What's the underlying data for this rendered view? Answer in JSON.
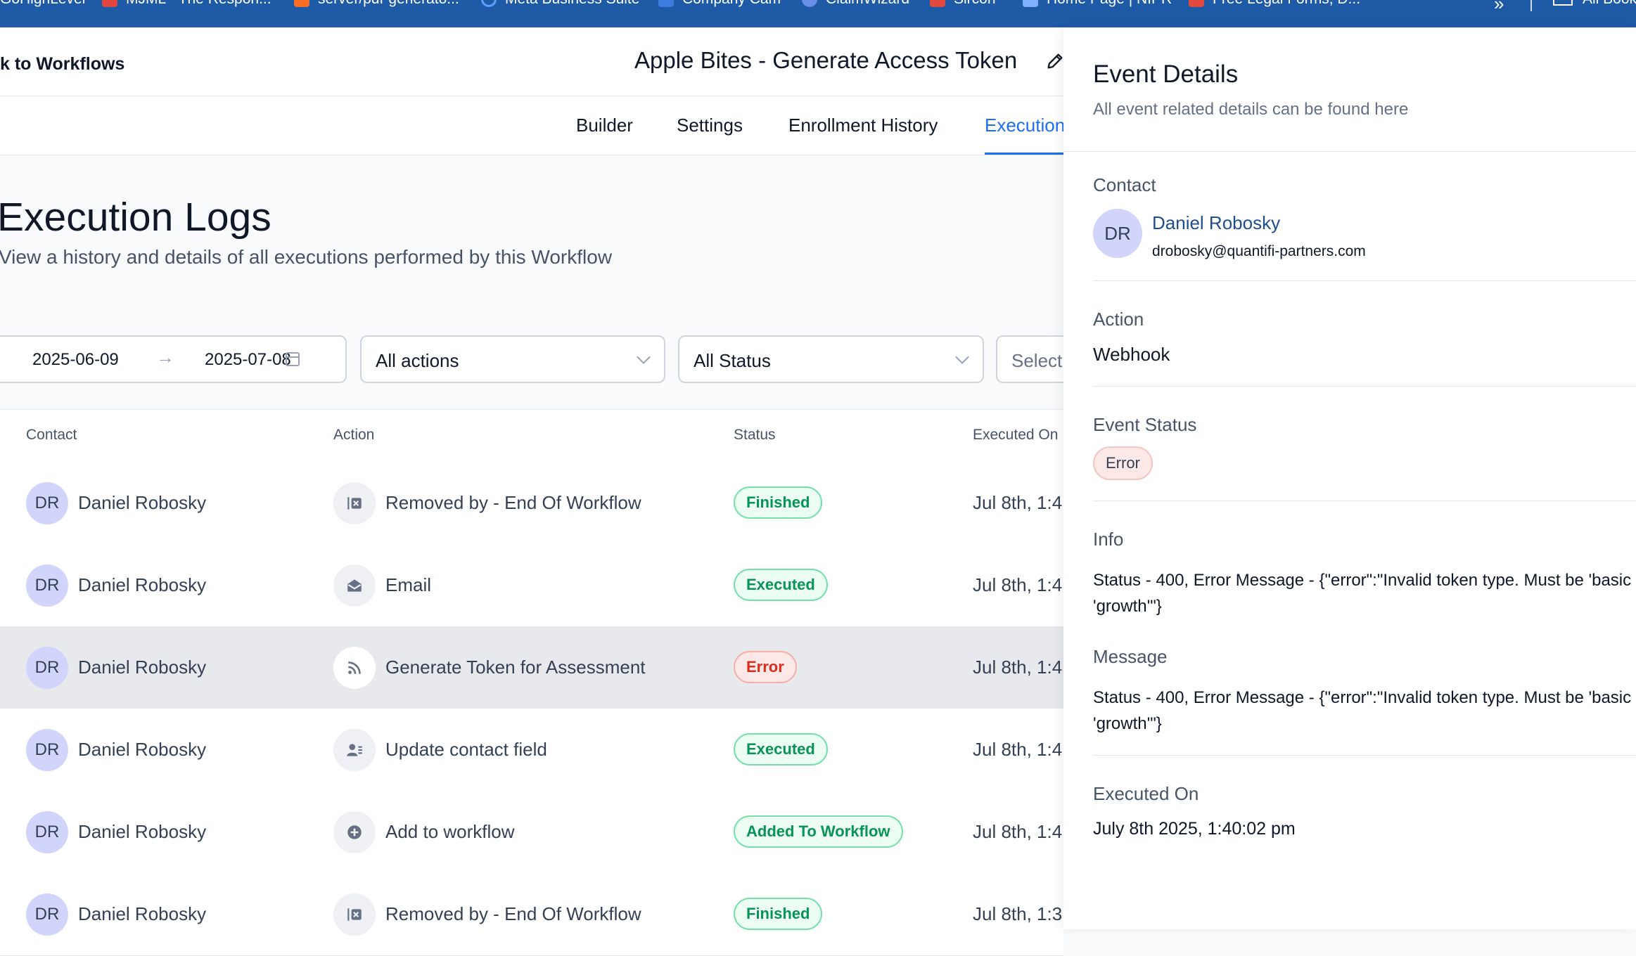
{
  "bookmarks": [
    {
      "label": "GoHighLevel",
      "icon": "ghl-icon",
      "color": "#ffffff"
    },
    {
      "label": "MJML - The Respon...",
      "icon": "mjml-icon",
      "color": "#e2473f"
    },
    {
      "label": "server/pdf-generato...",
      "icon": "gitlab-icon",
      "color": "#fc6d26"
    },
    {
      "label": "Meta Business Suite",
      "icon": "meta-icon",
      "color": "#5aa0ff"
    },
    {
      "label": "Company Cam",
      "icon": "camera-icon",
      "color": "#3d7de0"
    },
    {
      "label": "ClaimWizard",
      "icon": "wizard-icon",
      "color": "#6a8fe8"
    },
    {
      "label": "Sircon",
      "icon": "sircon-icon",
      "color": "#e24a3f"
    },
    {
      "label": "Home Page | NIPR",
      "icon": "nipr-icon",
      "color": "#7fb0ff"
    },
    {
      "label": "Free Legal Forms, D...",
      "icon": "legal-icon",
      "color": "#e24a3f"
    }
  ],
  "bookmarks_overflow": "»",
  "bookmarks_all": "All Book",
  "header": {
    "back_label": "k to Workflows",
    "workflow_title": "Apple Bites - Generate Access Token"
  },
  "tabs": [
    {
      "label": "Builder",
      "active": false
    },
    {
      "label": "Settings",
      "active": false
    },
    {
      "label": "Enrollment History",
      "active": false
    },
    {
      "label": "Execution",
      "active": true
    }
  ],
  "page": {
    "title": "Execution Logs",
    "subtitle": "View a history and details of all executions performed by this Workflow"
  },
  "filters": {
    "date_start": "2025-06-09",
    "date_arrow": "→",
    "date_end": "2025-07-08",
    "actions_value": "All actions",
    "status_value": "All Status",
    "third_placeholder": "Select"
  },
  "table": {
    "columns": [
      "Contact",
      "Action",
      "Status",
      "Executed On"
    ],
    "rows": [
      {
        "initials": "DR",
        "contact": "Daniel Robosky",
        "action_icon": "workflow-exit-icon",
        "action": "Removed by - End Of Workflow",
        "status": "Finished",
        "status_kind": "green",
        "executed": "Jul 8th, 1:4",
        "selected": false
      },
      {
        "initials": "DR",
        "contact": "Daniel Robosky",
        "action_icon": "email-icon",
        "action": "Email",
        "status": "Executed",
        "status_kind": "green",
        "executed": "Jul 8th, 1:4",
        "selected": false
      },
      {
        "initials": "DR",
        "contact": "Daniel Robosky",
        "action_icon": "webhook-icon",
        "action": "Generate Token for Assessment",
        "status": "Error",
        "status_kind": "red",
        "executed": "Jul 8th, 1:4",
        "selected": true
      },
      {
        "initials": "DR",
        "contact": "Daniel Robosky",
        "action_icon": "contact-field-icon",
        "action": "Update contact field",
        "status": "Executed",
        "status_kind": "green",
        "executed": "Jul 8th, 1:4",
        "selected": false
      },
      {
        "initials": "DR",
        "contact": "Daniel Robosky",
        "action_icon": "add-workflow-icon",
        "action": "Add to workflow",
        "status": "Added To Workflow",
        "status_kind": "green",
        "executed": "Jul 8th, 1:4",
        "selected": false
      },
      {
        "initials": "DR",
        "contact": "Daniel Robosky",
        "action_icon": "workflow-exit-icon",
        "action": "Removed by - End Of Workflow",
        "status": "Finished",
        "status_kind": "green",
        "executed": "Jul 8th, 1:3",
        "selected": false
      }
    ]
  },
  "event_details": {
    "title": "Event Details",
    "subtitle": "All event related details can be found here",
    "contact_label": "Contact",
    "contact_initials": "DR",
    "contact_name": "Daniel Robosky",
    "contact_email": "drobosky@quantifi-partners.com",
    "action_label": "Action",
    "action_value": "Webhook",
    "status_label": "Event Status",
    "status_value": "Error",
    "info_label": "Info",
    "info_line1": "Status - 400, Error Message - {\"error\":\"Invalid token type. Must be 'basic",
    "info_line2": "'growth'\"}",
    "message_label": "Message",
    "message_line1": "Status - 400, Error Message - {\"error\":\"Invalid token type. Must be 'basic",
    "message_line2": "'growth'\"}",
    "executed_label": "Executed On",
    "executed_value": "July 8th 2025, 1:40:02 pm"
  },
  "colors": {
    "accent": "#1d6ef5",
    "bookmarks_bar": "#1f5aa6",
    "success": "#079455",
    "error": "#d92d20"
  }
}
